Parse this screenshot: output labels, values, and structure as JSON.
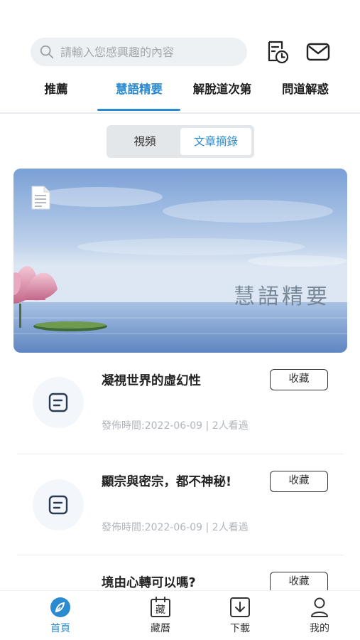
{
  "search": {
    "placeholder": "請輸入您感興趣的內容",
    "icon": "search-icon"
  },
  "header_icons": {
    "history": "history-icon",
    "mail": "mail-icon"
  },
  "tabs": [
    {
      "label": "推薦",
      "active": false
    },
    {
      "label": "慧語精要",
      "active": true
    },
    {
      "label": "解脫道次第",
      "active": false
    },
    {
      "label": "問道解惑",
      "active": false
    }
  ],
  "segment": {
    "video": "視頻",
    "article": "文章摘錄",
    "selected": "article"
  },
  "banner": {
    "title": "慧語精要",
    "icon": "document-icon"
  },
  "articles": [
    {
      "title": "凝視世界的虛幻性",
      "meta": "發佈時間:2022-06-09 | 2人看過",
      "action": "收藏"
    },
    {
      "title": "顯宗與密宗，都不神秘!",
      "meta": "發佈時間:2022-06-09 | 2人看過",
      "action": "收藏"
    },
    {
      "title": "境由心轉可以嗎?",
      "meta": "",
      "action": "收藏"
    }
  ],
  "bottom_nav": [
    {
      "label": "首頁",
      "icon": "compass-icon",
      "active": true
    },
    {
      "label": "藏曆",
      "icon": "calendar-icon",
      "calendar_glyph": "藏",
      "active": false
    },
    {
      "label": "下載",
      "icon": "download-icon",
      "active": false
    },
    {
      "label": "我的",
      "icon": "profile-icon",
      "active": false
    }
  ],
  "colors": {
    "accent": "#2a8bd0",
    "text": "#222222",
    "muted": "#b1b6bb"
  }
}
